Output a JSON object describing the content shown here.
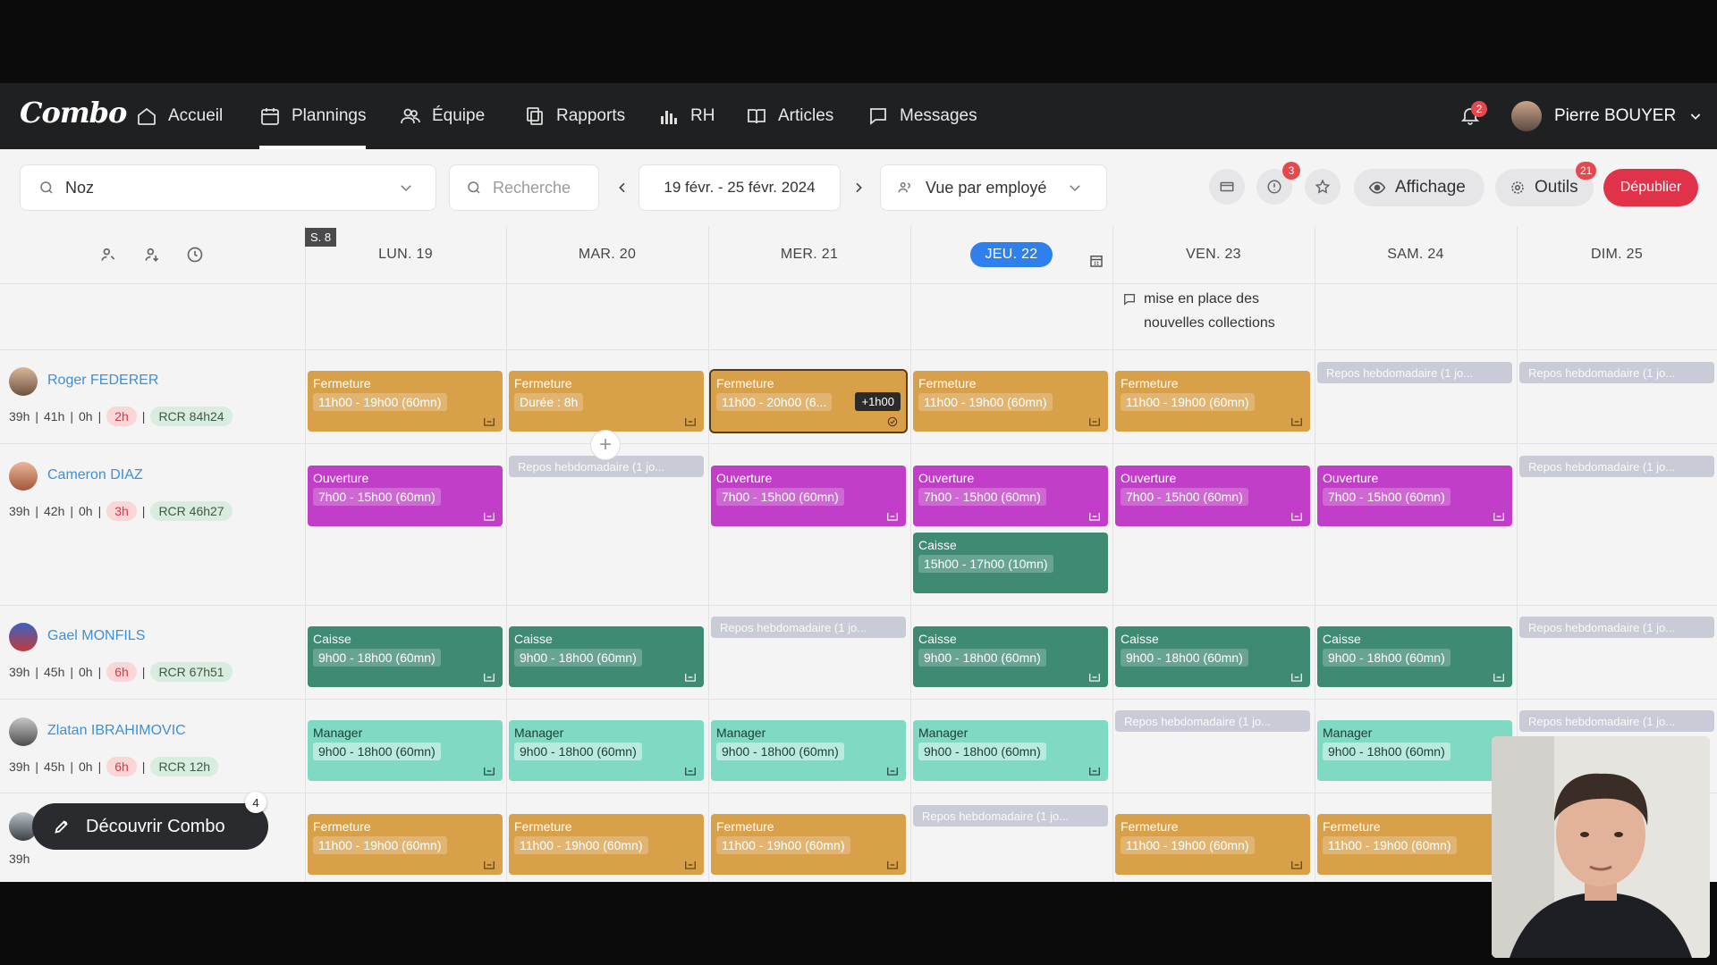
{
  "app": {
    "logo": "Combo"
  },
  "nav": {
    "items": [
      {
        "label": "Accueil"
      },
      {
        "label": "Plannings"
      },
      {
        "label": "Équipe"
      },
      {
        "label": "Rapports"
      },
      {
        "label": "RH"
      },
      {
        "label": "Articles"
      },
      {
        "label": "Messages"
      }
    ],
    "active": "Plannings",
    "notifications_count": "2",
    "user_name": "Pierre BOUYER"
  },
  "toolbar": {
    "store_value": "Noz",
    "search_placeholder": "Recherche",
    "date_range": "19 févr. - 25 févr. 2024",
    "view_value": "Vue par employé",
    "alerts_badge": "3",
    "display_label": "Affichage",
    "tools_label": "Outils",
    "tools_badge": "21",
    "publish_label": "Dépublier"
  },
  "calendar": {
    "week_tag": "S. 8",
    "days": [
      "LUN. 19",
      "MAR. 20",
      "MER. 21",
      "JEU. 22",
      "VEN. 23",
      "SAM. 24",
      "DIM. 25"
    ],
    "today_index": 3,
    "note_line1": "mise en place des",
    "note_line2": "nouvelles collections"
  },
  "employees": [
    {
      "name": "Roger FEDERER",
      "h1": "39h",
      "h2": "41h",
      "h3": "0h",
      "extra": "2h",
      "rcr": "RCR 84h24"
    },
    {
      "name": "Cameron DIAZ",
      "h1": "39h",
      "h2": "42h",
      "h3": "0h",
      "extra": "3h",
      "rcr": "RCR 46h27"
    },
    {
      "name": "Gael MONFILS",
      "h1": "39h",
      "h2": "45h",
      "h3": "0h",
      "extra": "6h",
      "rcr": "RCR 67h51"
    },
    {
      "name": "Zlatan IBRAHIMOVIC",
      "h1": "39h",
      "h2": "45h",
      "h3": "0h",
      "extra": "6h",
      "rcr": "RCR 12h"
    },
    {
      "h1": "39h"
    }
  ],
  "shift_labels": {
    "fermeture": "Fermeture",
    "ouverture": "Ouverture",
    "caisse": "Caisse",
    "manager": "Manager",
    "h_11_19": "11h00 - 19h00 (60mn)",
    "h_duree": "Durée : 8h",
    "h_11_20": "11h00 - 20h00 (6...",
    "overtime": "+1h00",
    "h_7_15": "7h00 - 15h00 (60mn)",
    "h_15_17": "15h00 - 17h00 (10mn)",
    "h_9_18": "9h00 - 18h00 (60mn)",
    "repos": "Repos hebdomadaire (1 jo..."
  },
  "discover": {
    "label": "Découvrir Combo",
    "badge": "4"
  },
  "colors": {
    "nav_bg": "#1f2022",
    "publish": "#e0334a",
    "today": "#2f80ed",
    "fermeture": "#d9a04a",
    "ouverture": "#c13fc8",
    "caisse": "#3f8a72",
    "manager": "#80d9c3",
    "repos": "#c9ccd6"
  }
}
